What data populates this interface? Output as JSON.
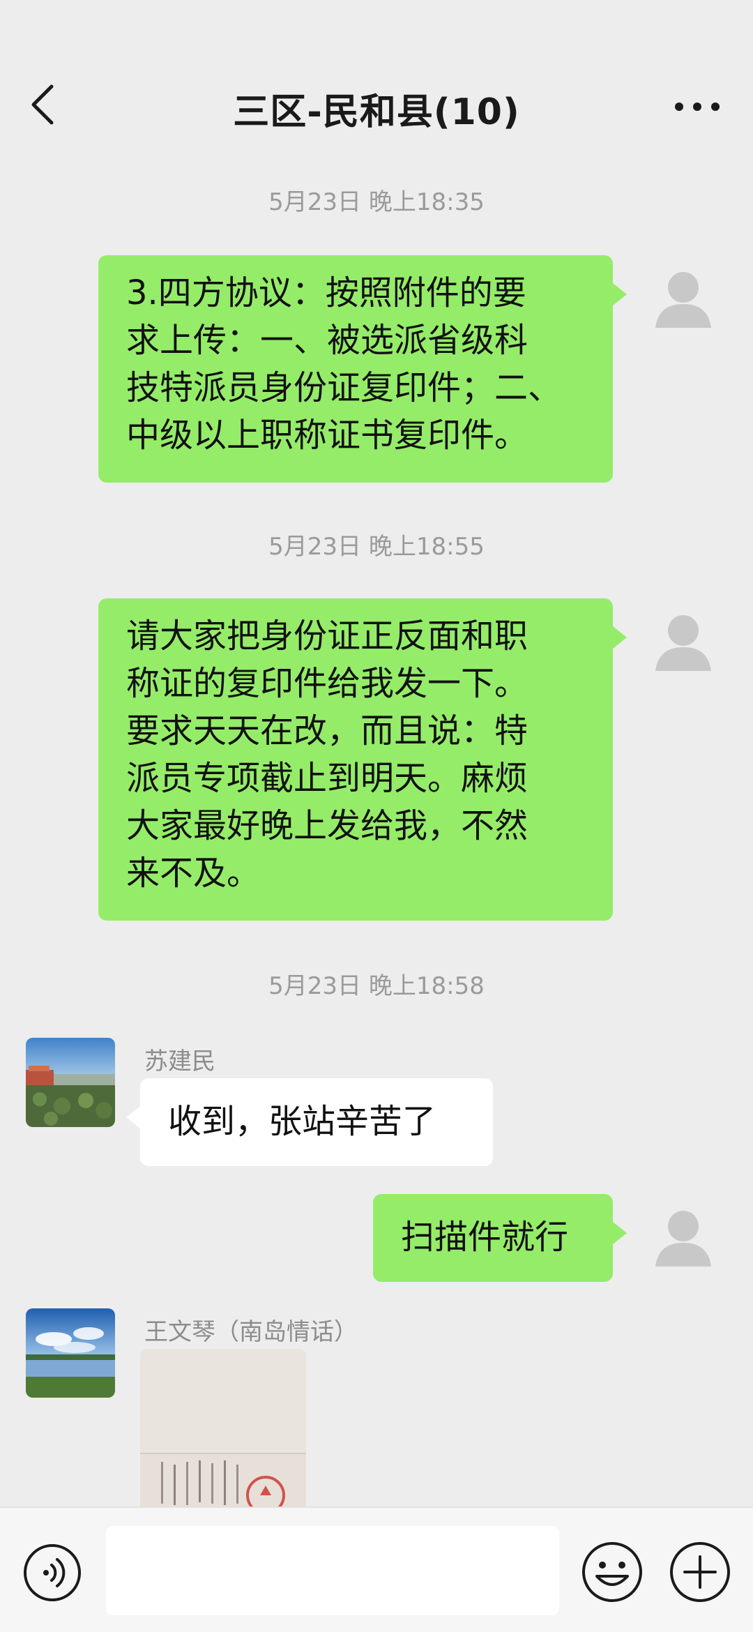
{
  "header": {
    "title": "三区-民和县(10)",
    "back_icon": "chevron-left-icon",
    "more_icon": "more-dots-icon"
  },
  "messages": [
    {
      "type": "timestamp",
      "text": "5月23日 晚上18:35"
    },
    {
      "type": "text",
      "side": "me",
      "lines": [
        "3.四方协议：按照附件的要",
        "求上传：一、被选派省级科",
        "技特派员身份证复印件；二、",
        "中级以上职称证书复印件。"
      ]
    },
    {
      "type": "timestamp",
      "text": "5月23日 晚上18:55"
    },
    {
      "type": "text",
      "side": "me",
      "lines": [
        "请大家把身份证正反面和职",
        "称证的复印件给我发一下。",
        "要求天天在改，而且说：特",
        "派员专项截止到明天。麻烦",
        "大家最好晚上发给我，不然",
        "来不及。"
      ]
    },
    {
      "type": "timestamp",
      "text": "5月23日 晚上18:58"
    },
    {
      "type": "text",
      "side": "other",
      "sender": "苏建民",
      "text": "收到，张站辛苦了"
    },
    {
      "type": "text",
      "side": "me",
      "text": "扫描件就行"
    },
    {
      "type": "image",
      "side": "other",
      "sender": "王文琴（南岛情话）"
    }
  ],
  "input": {
    "value": "",
    "placeholder": ""
  },
  "toolbar": {
    "voice_icon": "voice-icon",
    "emoji_icon": "emoji-icon",
    "plus_icon": "plus-icon"
  },
  "colors": {
    "background": "#ededed",
    "my_bubble": "#95ec69",
    "other_bubble": "#ffffff",
    "timestamp_text": "#9a9a9a",
    "sender_text": "#8c8c8c"
  }
}
